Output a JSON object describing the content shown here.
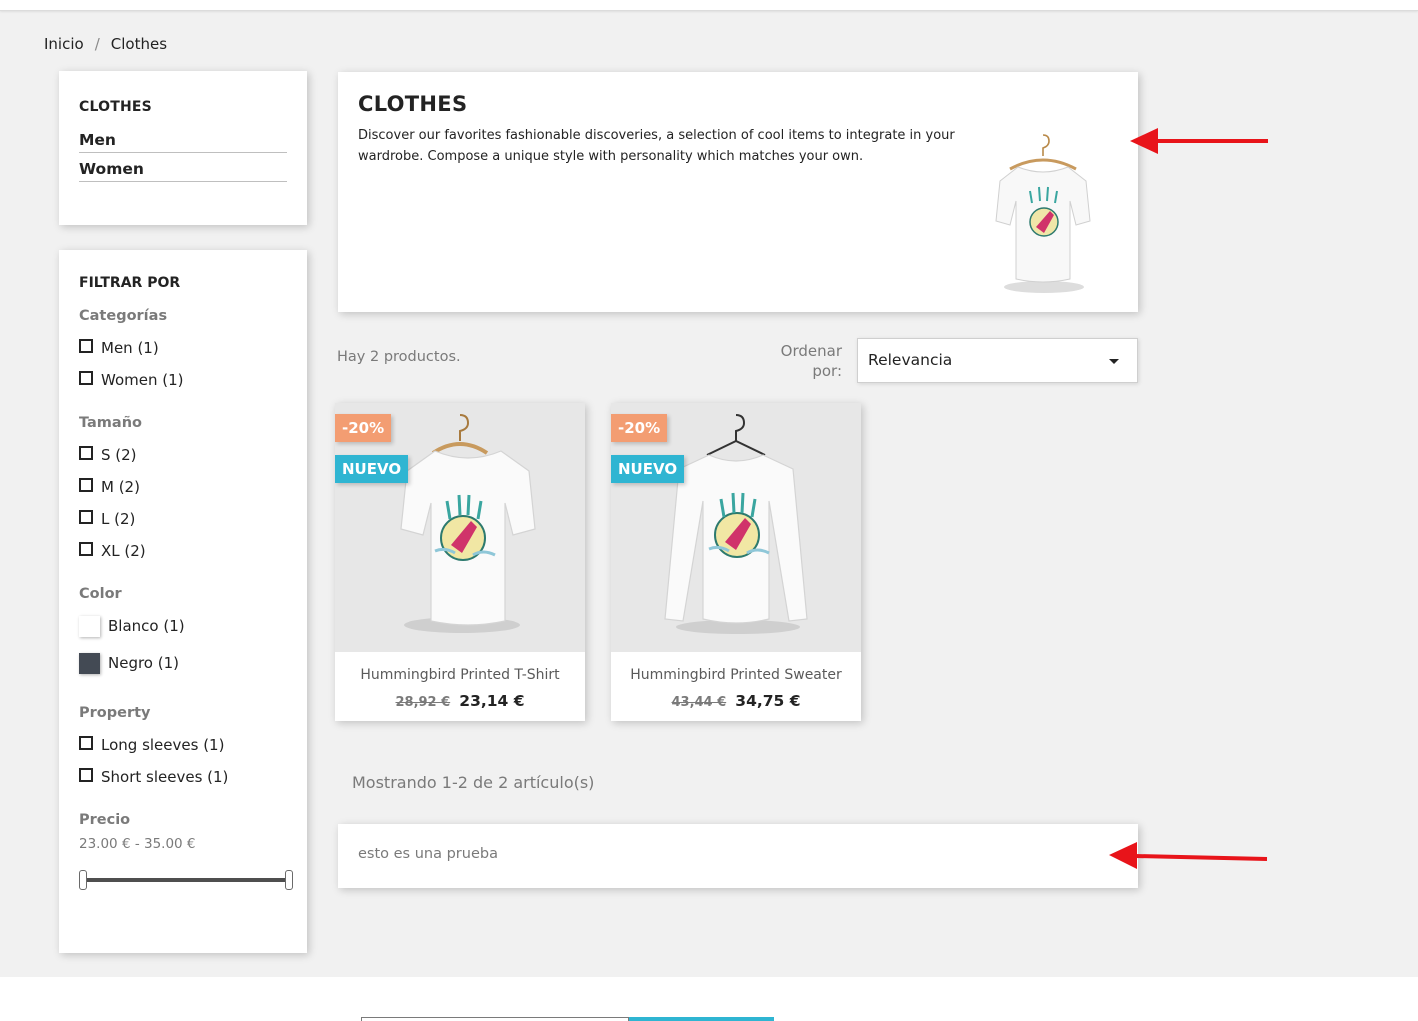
{
  "breadcrumb": {
    "home": "Inicio",
    "separator": "/",
    "current": "Clothes"
  },
  "category_block": {
    "title": "CLOTHES",
    "items": [
      "Men",
      "Women"
    ]
  },
  "filters": {
    "title": "FILTRAR POR",
    "categories": {
      "title": "Categorías",
      "options": [
        "Men (1)",
        "Women (1)"
      ]
    },
    "size": {
      "title": "Tamaño",
      "options": [
        "S (2)",
        "M (2)",
        "L (2)",
        "XL (2)"
      ]
    },
    "color": {
      "title": "Color",
      "options": [
        {
          "label": "Blanco (1)",
          "color": "#ffffff"
        },
        {
          "label": "Negro (1)",
          "color": "#434a54"
        }
      ]
    },
    "property": {
      "title": "Property",
      "options": [
        "Long sleeves (1)",
        "Short sleeves (1)"
      ]
    },
    "price": {
      "title": "Precio",
      "range": "23.00 € - 35.00 €",
      "min": 23.0,
      "max": 35.0
    }
  },
  "header": {
    "title": "CLOTHES",
    "description": "Discover our favorites fashionable discoveries, a selection of cool items to integrate in your wardrobe. Compose a unique style with personality which matches your own."
  },
  "listing": {
    "count_text": "Hay 2 productos.",
    "sort_label": "Ordenar por:",
    "sort_value": "Relevancia",
    "pagination": "Mostrando 1-2 de 2 artículo(s)"
  },
  "products": [
    {
      "name": "Hummingbird Printed T-Shirt",
      "old_price": "28,92 €",
      "price": "23,14 €",
      "discount": "-20%",
      "badge": "NUEVO"
    },
    {
      "name": "Hummingbird Printed Sweater",
      "old_price": "43,44 €",
      "price": "34,75 €",
      "discount": "-20%",
      "badge": "NUEVO"
    }
  ],
  "footer_description": "esto es una prueba",
  "colors": {
    "accent": "#2fb5d2",
    "discount": "#f39d72",
    "arrow": "#e8141a"
  },
  "icons": [
    "caret-down-icon",
    "arrow-annotation-icon"
  ]
}
